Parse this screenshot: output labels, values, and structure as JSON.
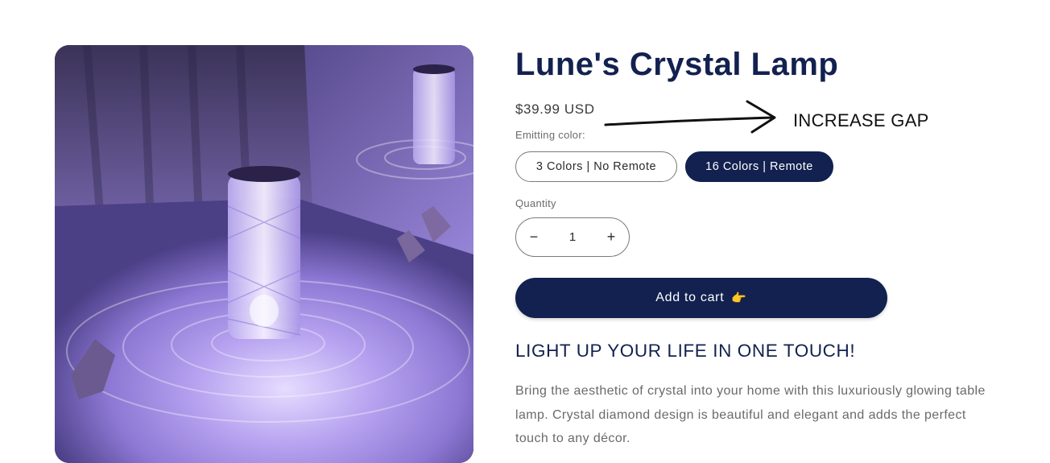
{
  "product": {
    "title": "Lune's Crystal Lamp",
    "price": "$39.99 USD",
    "variant_label": "Emitting color:",
    "variants": [
      {
        "label": "3 Colors | No Remote",
        "selected": false
      },
      {
        "label": "16 Colors | Remote",
        "selected": true
      }
    ],
    "quantity_label": "Quantity",
    "quantity_value": "1",
    "quantity_minus": "−",
    "quantity_plus": "+",
    "add_to_cart_label": "Add to cart",
    "add_to_cart_emoji": "👉",
    "headline": "LIGHT UP YOUR LIFE IN ONE TOUCH!",
    "description": "Bring the aesthetic of crystal into your home with this luxuriously glowing table lamp. Crystal diamond design is beautiful and elegant and adds the perfect touch to any décor."
  },
  "media": {
    "icon": "product-photo"
  },
  "annotation": {
    "text": "INCREASE GAP",
    "icon": "arrow-right-icon"
  },
  "colors": {
    "brand_navy": "#12214f",
    "text_muted": "#6a6a6a"
  }
}
